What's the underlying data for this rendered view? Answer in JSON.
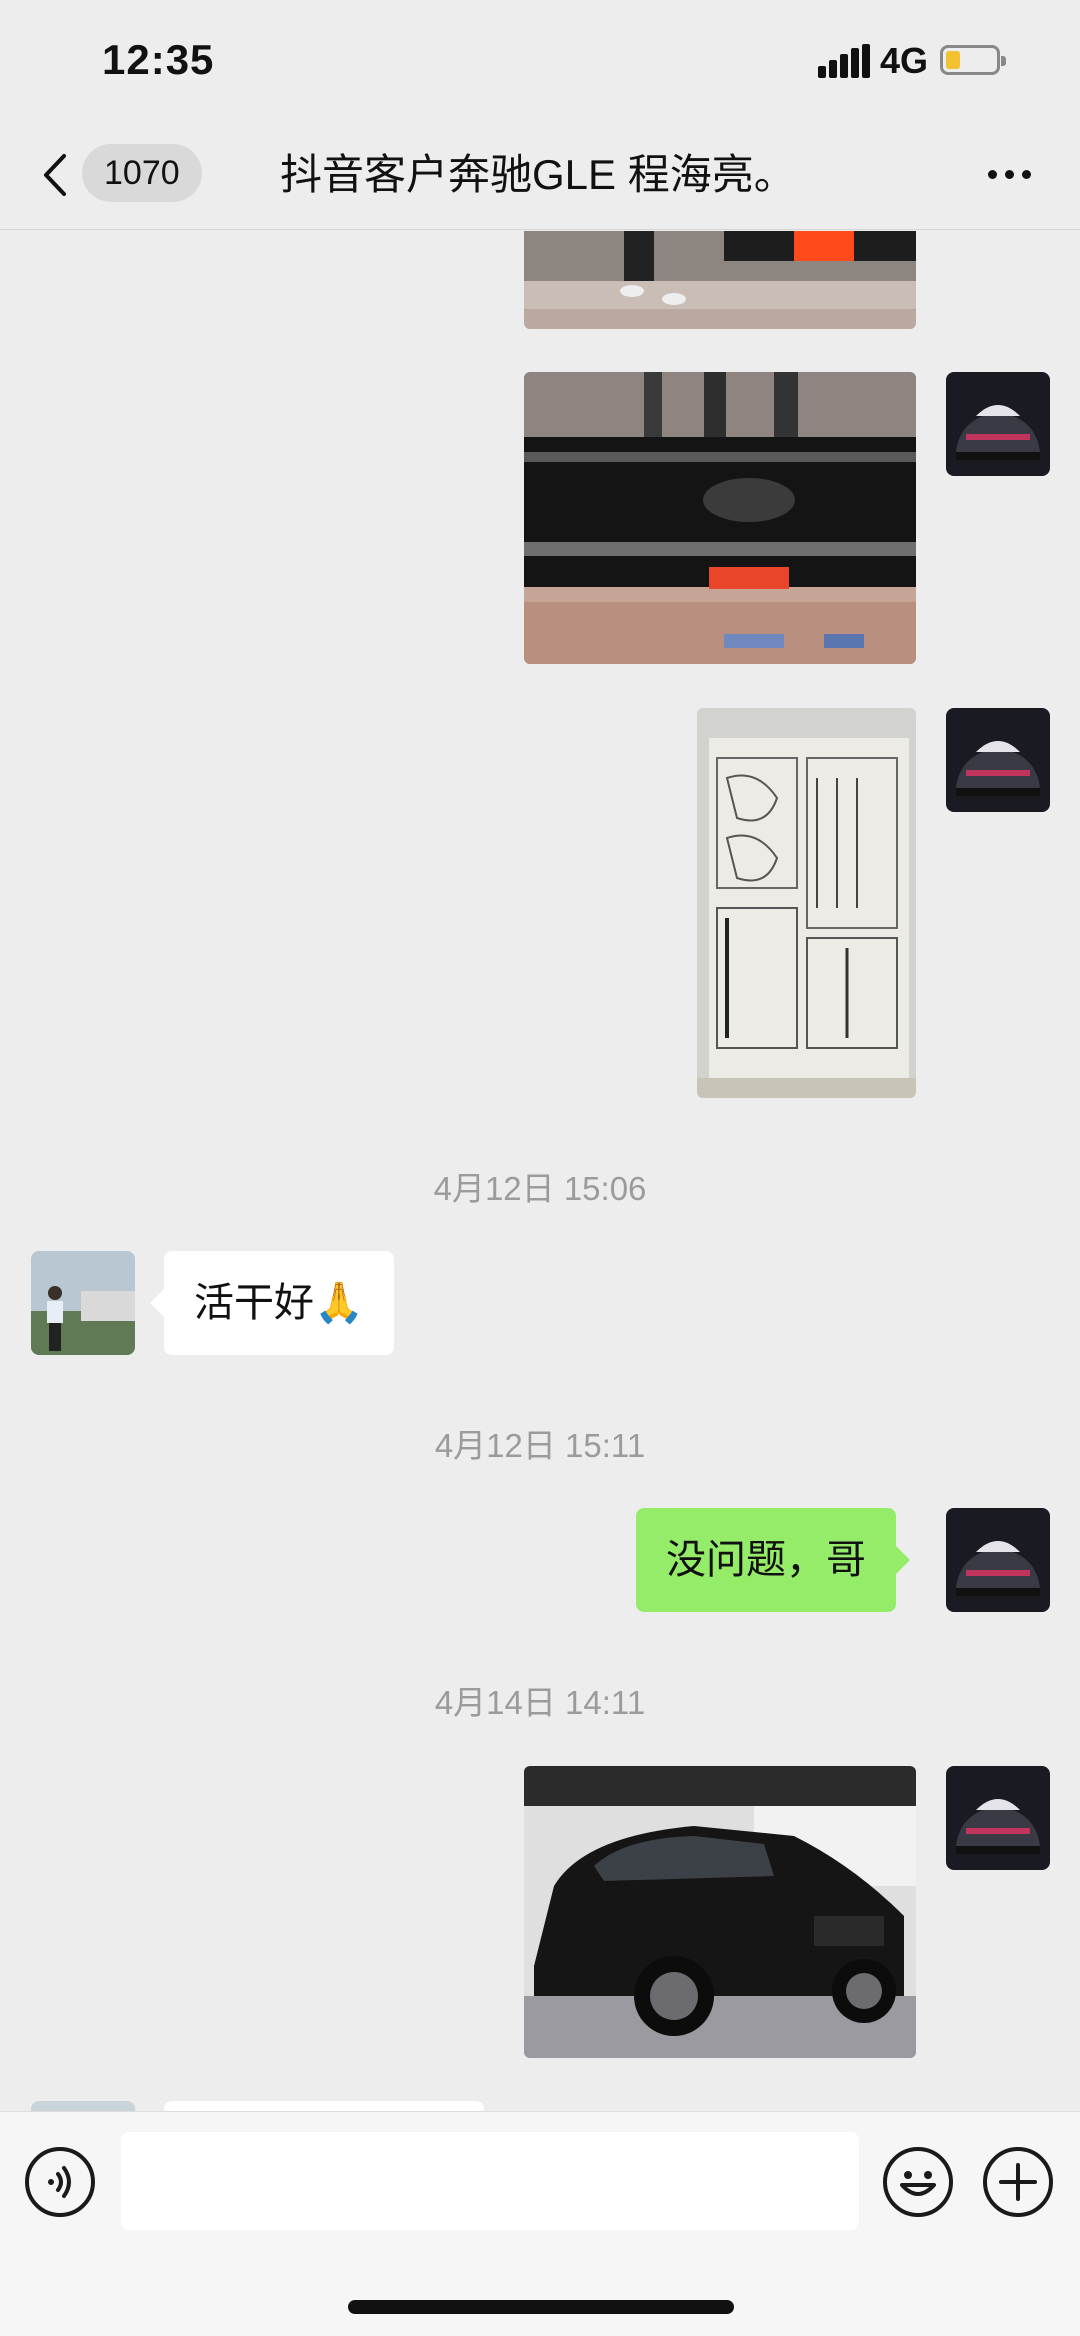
{
  "status_bar": {
    "time": "12:35",
    "network": "4G",
    "battery_level": 0.2
  },
  "nav": {
    "unread_count": "1070",
    "title": "抖音客户奔驰GLE 程海亮。",
    "back_icon": "chevron-left-icon",
    "more_icon": "ellipsis-icon"
  },
  "messages": {
    "timestamp_1": "4月12日 15:06",
    "text_1": "活干好🙏",
    "timestamp_2": "4月12日 15:11",
    "text_2": "没问题，哥",
    "timestamp_3": "4月14日 14:11"
  },
  "input_bar": {
    "placeholder": "",
    "voice_icon": "voice-icon",
    "emoji_icon": "emoji-icon",
    "plus_icon": "plus-icon"
  },
  "colors": {
    "background": "#ededed",
    "self_bubble": "#95ec69",
    "other_bubble": "#ffffff",
    "timestamp": "#9b9b9b"
  }
}
